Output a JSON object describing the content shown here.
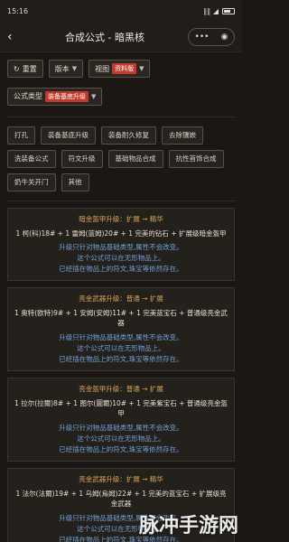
{
  "status": {
    "time": "15:16",
    "icons": "◘ ▣ ▣ ◎ ▪",
    "signal": "∥∥ ◢",
    "battery_text": "100"
  },
  "titlebar": {
    "back_icon": "back-chevron-icon",
    "title": "合成公式 - 暗黑核",
    "menu_glyph": "•••",
    "close_glyph": "◉"
  },
  "toolbar": {
    "reset_label": "重置",
    "version_label": "版本",
    "view_label": "视图",
    "view_badge": "资料版",
    "formula_type_label": "公式类型",
    "formula_type_badge": "装备基底升级"
  },
  "tags": [
    "打孔",
    "装备基底升级",
    "装备耐久修复",
    "去除镶嵌",
    "洗装备公式",
    "符文升级",
    "基础物品合成",
    "抗性首饰合成",
    "奶牛关开门",
    "其他"
  ],
  "cards": [
    {
      "title": "暗金盔甲升级：扩展 → 精华",
      "recipe": "1 柯(科)18# + 1 雷姆(蓝姆)20# + 1 完美的钻石 + 扩展级暗金盔甲",
      "desc": [
        "升级只针对物品基础类型,属性不会改变。",
        "这个公式可以在无形物品上。",
        "已经插在物品上的符文,珠宝等依然存在。"
      ]
    },
    {
      "title": "亮金武器升级：普通 → 扩展",
      "recipe": "1 奥特(欧特)9# + 1 安姆(安姆)11# + 1 完美蓝宝石 + 普通级亮金武器",
      "desc": [
        "升级只针对物品基础类型,属性不会改变。",
        "这个公式可以在无形物品上。",
        "已经插在物品上的符文,珠宝等依然存在。"
      ]
    },
    {
      "title": "亮金盔甲升级：普通 → 扩展",
      "recipe": "1 拉尔(拉爾)8# + 1 图尔(圖爾)10# + 1 完美紫宝石 + 普通级亮金盔甲",
      "desc": [
        "升级只针对物品基础类型,属性不会改变。",
        "这个公式可以在无形物品上。",
        "已经插在物品上的符文,珠宝等依然存在。"
      ]
    },
    {
      "title": "亮金武器升级：扩展 → 精华",
      "recipe": "1 法尔(法爾)19# + 1 乌姆(烏姆)22# + 1 完美的蓝宝石 + 扩展级亮金武器",
      "desc": [
        "升级只针对物品基础类型,属性不会改变。",
        "这个公式可以在无形物品上。",
        "已经插在物品上的符文,珠宝等依然存在。"
      ]
    }
  ],
  "watermark": "脉冲手游网"
}
